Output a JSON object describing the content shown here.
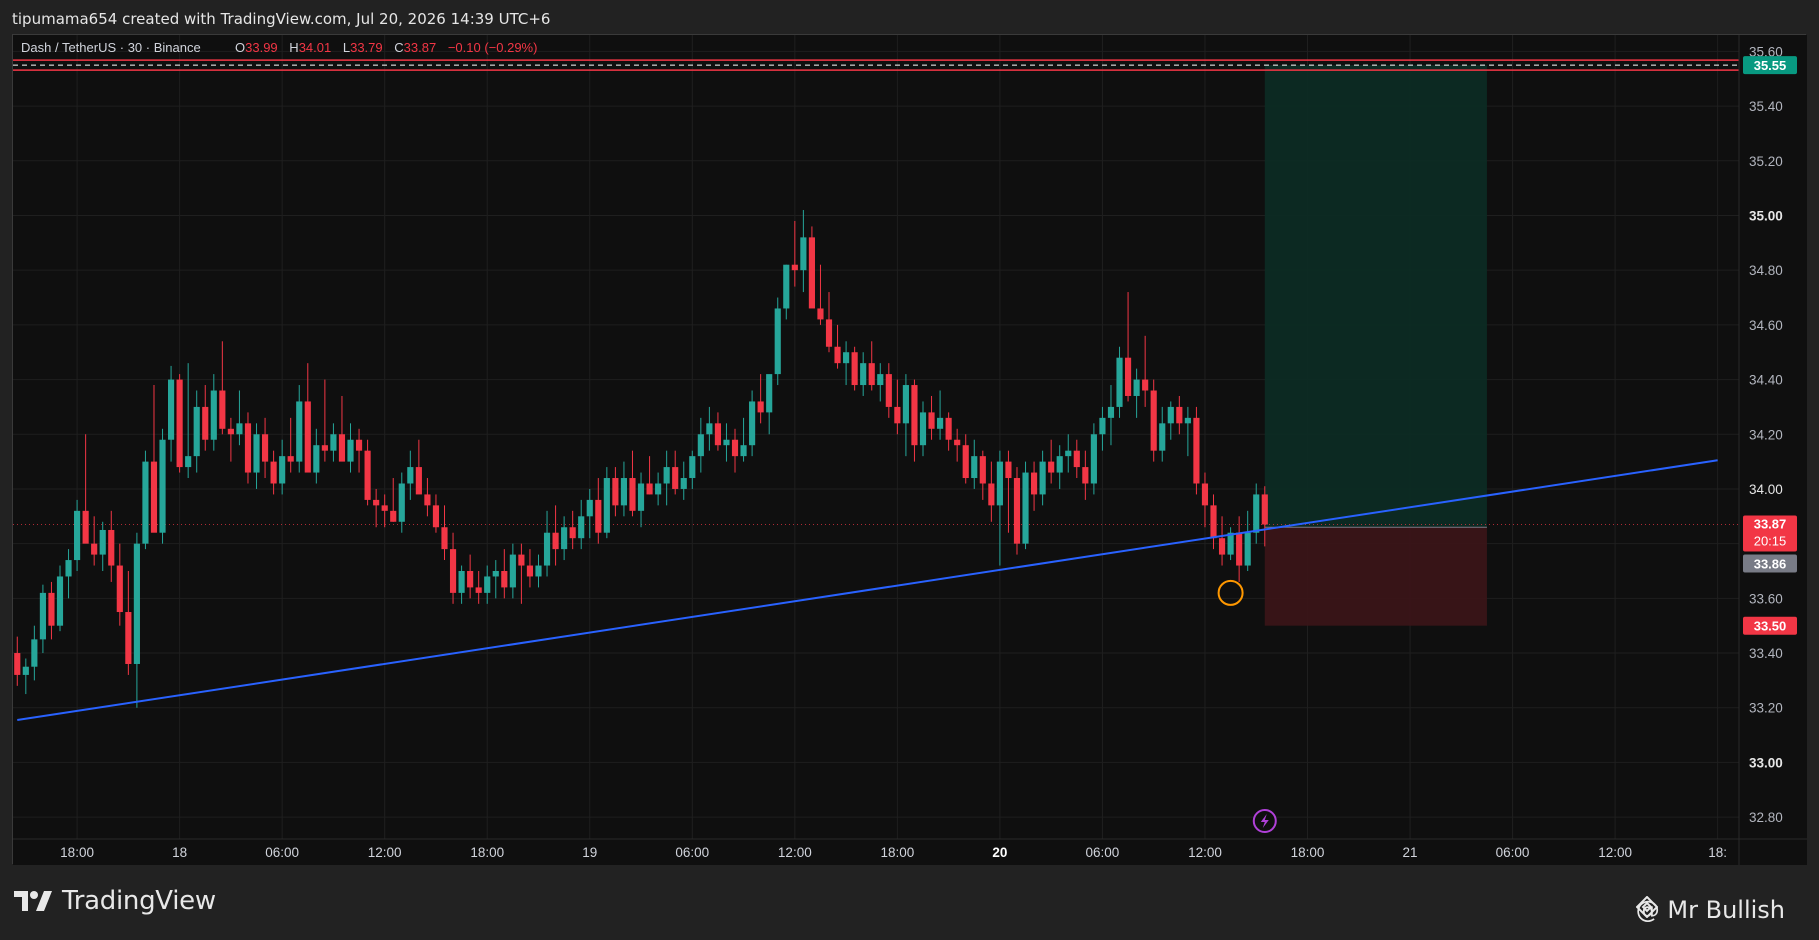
{
  "header": {
    "text": "tipumama654 created with TradingView.com, Jul 20, 2026 14:39 UTC+6"
  },
  "legend": {
    "symbol": "Dash / TetherUS · 30 · Binance",
    "o_label": "O",
    "o_value": "33.99",
    "h_label": "H",
    "h_value": "34.01",
    "l_label": "L",
    "l_value": "33.79",
    "c_label": "C",
    "c_value": "33.87",
    "change": "−0.10 (−0.29%)"
  },
  "colors": {
    "up": "#26a69a",
    "down": "#f23645",
    "trendline": "#2962ff",
    "target_zone": "#0d2b24",
    "stop_zone": "#3a1518",
    "badge_red": "#f23645",
    "badge_teal": "#089981",
    "badge_gray": "#787b86"
  },
  "footer": {
    "brand": "TradingView",
    "author": "@ Mr Bullish",
    "brand_icon": "tradingview-logo-icon",
    "author_icon": "binance-diamond-icon"
  },
  "chart_data": {
    "type": "candlestick",
    "yticks": [
      32.8,
      33.0,
      33.2,
      33.4,
      33.6,
      33.8,
      34.0,
      34.2,
      34.4,
      34.6,
      34.8,
      35.0,
      35.2,
      35.4,
      35.6
    ],
    "ytick_labels": [
      "32.80",
      "33.00",
      "33.20",
      "33.40",
      "33.60",
      "33.80",
      "34.00",
      "34.20",
      "34.40",
      "34.60",
      "34.80",
      "35.00",
      "35.20",
      "35.40",
      "35.60"
    ],
    "ylim": [
      32.72,
      35.66
    ],
    "xticks": [
      {
        "label": "18:00",
        "bar": 7
      },
      {
        "label": "18",
        "bar": 19
      },
      {
        "label": "06:00",
        "bar": 31
      },
      {
        "label": "12:00",
        "bar": 43
      },
      {
        "label": "18:00",
        "bar": 55
      },
      {
        "label": "19",
        "bar": 67
      },
      {
        "label": "06:00",
        "bar": 79
      },
      {
        "label": "12:00",
        "bar": 91
      },
      {
        "label": "18:00",
        "bar": 103
      },
      {
        "label": "20",
        "bar": 115,
        "bold": true
      },
      {
        "label": "06:00",
        "bar": 127
      },
      {
        "label": "12:00",
        "bar": 139
      },
      {
        "label": "18:00",
        "bar": 151
      },
      {
        "label": "21",
        "bar": 163
      },
      {
        "label": "06:00",
        "bar": 175
      },
      {
        "label": "12:00",
        "bar": 187
      },
      {
        "label": "18:",
        "bar": 199
      }
    ],
    "xlim_bars": [
      -0.5,
      201.5
    ],
    "ohlc": [
      [
        33.4,
        33.46,
        33.28,
        33.32
      ],
      [
        33.32,
        33.38,
        33.25,
        33.35
      ],
      [
        33.35,
        33.5,
        33.3,
        33.45
      ],
      [
        33.45,
        33.65,
        33.4,
        33.62
      ],
      [
        33.62,
        33.66,
        33.45,
        33.5
      ],
      [
        33.5,
        33.72,
        33.48,
        33.68
      ],
      [
        33.68,
        33.78,
        33.6,
        33.74
      ],
      [
        33.74,
        33.96,
        33.7,
        33.92
      ],
      [
        33.92,
        34.2,
        33.86,
        33.8
      ],
      [
        33.8,
        33.9,
        33.72,
        33.76
      ],
      [
        33.76,
        33.88,
        33.7,
        33.85
      ],
      [
        33.85,
        33.92,
        33.66,
        33.72
      ],
      [
        33.72,
        33.8,
        33.5,
        33.55
      ],
      [
        33.55,
        33.7,
        33.32,
        33.36
      ],
      [
        33.36,
        33.84,
        33.2,
        33.8
      ],
      [
        33.8,
        34.14,
        33.78,
        34.1
      ],
      [
        34.1,
        34.38,
        33.88,
        33.84
      ],
      [
        33.84,
        34.22,
        33.8,
        34.18
      ],
      [
        34.18,
        34.45,
        34.1,
        34.4
      ],
      [
        34.4,
        34.42,
        34.06,
        34.08
      ],
      [
        34.08,
        34.46,
        34.04,
        34.12
      ],
      [
        34.12,
        34.36,
        34.06,
        34.3
      ],
      [
        34.3,
        34.38,
        34.14,
        34.18
      ],
      [
        34.18,
        34.42,
        34.14,
        34.36
      ],
      [
        34.36,
        34.54,
        34.2,
        34.22
      ],
      [
        34.22,
        34.26,
        34.1,
        34.2
      ],
      [
        34.2,
        34.36,
        34.16,
        34.24
      ],
      [
        34.24,
        34.28,
        34.02,
        34.06
      ],
      [
        34.06,
        34.24,
        34.0,
        34.2
      ],
      [
        34.2,
        34.26,
        34.04,
        34.1
      ],
      [
        34.1,
        34.14,
        33.98,
        34.02
      ],
      [
        34.02,
        34.18,
        33.98,
        34.12
      ],
      [
        34.12,
        34.26,
        34.06,
        34.1
      ],
      [
        34.1,
        34.38,
        34.06,
        34.32
      ],
      [
        34.32,
        34.46,
        34.2,
        34.06
      ],
      [
        34.06,
        34.22,
        34.02,
        34.16
      ],
      [
        34.16,
        34.4,
        34.1,
        34.14
      ],
      [
        34.14,
        34.24,
        34.1,
        34.2
      ],
      [
        34.2,
        34.34,
        34.14,
        34.1
      ],
      [
        34.1,
        34.24,
        34.06,
        34.18
      ],
      [
        34.18,
        34.22,
        34.06,
        34.14
      ],
      [
        34.14,
        34.18,
        33.94,
        33.96
      ],
      [
        33.96,
        34.0,
        33.86,
        33.94
      ],
      [
        33.94,
        33.98,
        33.86,
        33.92
      ],
      [
        33.92,
        34.04,
        33.88,
        33.88
      ],
      [
        33.88,
        34.06,
        33.84,
        34.02
      ],
      [
        34.02,
        34.14,
        33.96,
        34.08
      ],
      [
        34.08,
        34.18,
        34.0,
        33.98
      ],
      [
        33.98,
        34.04,
        33.9,
        33.94
      ],
      [
        33.94,
        33.98,
        33.84,
        33.86
      ],
      [
        33.86,
        33.94,
        33.74,
        33.78
      ],
      [
        33.78,
        33.84,
        33.58,
        33.62
      ],
      [
        33.62,
        33.72,
        33.58,
        33.7
      ],
      [
        33.7,
        33.76,
        33.6,
        33.64
      ],
      [
        33.64,
        33.7,
        33.58,
        33.62
      ],
      [
        33.62,
        33.72,
        33.58,
        33.68
      ],
      [
        33.68,
        33.74,
        33.6,
        33.7
      ],
      [
        33.7,
        33.78,
        33.6,
        33.64
      ],
      [
        33.64,
        33.8,
        33.6,
        33.76
      ],
      [
        33.76,
        33.8,
        33.58,
        33.72
      ],
      [
        33.72,
        33.78,
        33.64,
        33.68
      ],
      [
        33.68,
        33.76,
        33.64,
        33.72
      ],
      [
        33.72,
        33.92,
        33.68,
        33.84
      ],
      [
        33.84,
        33.94,
        33.72,
        33.78
      ],
      [
        33.78,
        33.9,
        33.74,
        33.86
      ],
      [
        33.86,
        33.92,
        33.78,
        33.82
      ],
      [
        33.82,
        33.96,
        33.78,
        33.9
      ],
      [
        33.9,
        34.0,
        33.82,
        33.96
      ],
      [
        33.96,
        34.04,
        33.8,
        33.84
      ],
      [
        33.84,
        34.08,
        33.82,
        34.04
      ],
      [
        34.04,
        34.08,
        33.9,
        33.94
      ],
      [
        33.94,
        34.1,
        33.9,
        34.04
      ],
      [
        34.04,
        34.14,
        33.9,
        33.92
      ],
      [
        33.92,
        34.06,
        33.86,
        34.02
      ],
      [
        34.02,
        34.12,
        33.98,
        33.98
      ],
      [
        33.98,
        34.06,
        33.94,
        34.02
      ],
      [
        34.02,
        34.14,
        33.94,
        34.08
      ],
      [
        34.08,
        34.14,
        33.98,
        34.0
      ],
      [
        34.0,
        34.1,
        33.96,
        34.04
      ],
      [
        34.04,
        34.14,
        34.0,
        34.12
      ],
      [
        34.12,
        34.26,
        34.06,
        34.2
      ],
      [
        34.2,
        34.3,
        34.14,
        34.24
      ],
      [
        34.24,
        34.28,
        34.14,
        34.16
      ],
      [
        34.16,
        34.24,
        34.1,
        34.18
      ],
      [
        34.18,
        34.22,
        34.06,
        34.12
      ],
      [
        34.12,
        34.26,
        34.1,
        34.16
      ],
      [
        34.16,
        34.36,
        34.12,
        34.32
      ],
      [
        34.32,
        34.42,
        34.24,
        34.28
      ],
      [
        34.28,
        34.4,
        34.2,
        34.42
      ],
      [
        34.42,
        34.7,
        34.38,
        34.66
      ],
      [
        34.66,
        34.82,
        34.62,
        34.82
      ],
      [
        34.82,
        34.98,
        34.74,
        34.8
      ],
      [
        34.8,
        35.02,
        34.72,
        34.92
      ],
      [
        34.92,
        34.96,
        34.78,
        34.66
      ],
      [
        34.66,
        34.82,
        34.6,
        34.62
      ],
      [
        34.62,
        34.72,
        34.5,
        34.52
      ],
      [
        34.52,
        34.6,
        34.44,
        34.46
      ],
      [
        34.46,
        34.54,
        34.38,
        34.5
      ],
      [
        34.5,
        34.52,
        34.36,
        34.38
      ],
      [
        34.38,
        34.5,
        34.34,
        34.46
      ],
      [
        34.46,
        34.54,
        34.36,
        34.38
      ],
      [
        34.38,
        34.46,
        34.32,
        34.42
      ],
      [
        34.42,
        34.46,
        34.26,
        34.3
      ],
      [
        34.3,
        34.4,
        34.2,
        34.24
      ],
      [
        34.24,
        34.42,
        34.12,
        34.38
      ],
      [
        34.38,
        34.4,
        34.1,
        34.16
      ],
      [
        34.16,
        34.32,
        34.12,
        34.28
      ],
      [
        34.28,
        34.34,
        34.18,
        34.22
      ],
      [
        34.22,
        34.36,
        34.18,
        34.26
      ],
      [
        34.26,
        34.28,
        34.14,
        34.18
      ],
      [
        34.18,
        34.22,
        34.1,
        34.16
      ],
      [
        34.16,
        34.2,
        34.02,
        34.04
      ],
      [
        34.04,
        34.18,
        34.0,
        34.12
      ],
      [
        34.12,
        34.14,
        33.96,
        34.02
      ],
      [
        34.02,
        34.1,
        33.88,
        33.94
      ],
      [
        33.94,
        34.14,
        33.72,
        34.1
      ],
      [
        34.1,
        34.14,
        33.84,
        34.04
      ],
      [
        34.04,
        34.08,
        33.76,
        33.8
      ],
      [
        33.8,
        34.1,
        33.78,
        34.06
      ],
      [
        34.06,
        34.1,
        33.92,
        33.98
      ],
      [
        33.98,
        34.14,
        33.94,
        34.1
      ],
      [
        34.1,
        34.18,
        34.02,
        34.06
      ],
      [
        34.06,
        34.16,
        34.0,
        34.12
      ],
      [
        34.12,
        34.2,
        34.06,
        34.14
      ],
      [
        34.14,
        34.18,
        34.04,
        34.08
      ],
      [
        34.08,
        34.14,
        33.96,
        34.02
      ],
      [
        34.02,
        34.24,
        33.98,
        34.2
      ],
      [
        34.2,
        34.3,
        34.14,
        34.26
      ],
      [
        34.26,
        34.38,
        34.16,
        34.3
      ],
      [
        34.3,
        34.52,
        34.26,
        34.48
      ],
      [
        34.48,
        34.72,
        34.32,
        34.34
      ],
      [
        34.34,
        34.44,
        34.26,
        34.4
      ],
      [
        34.4,
        34.56,
        34.3,
        34.36
      ],
      [
        34.36,
        34.4,
        34.1,
        34.14
      ],
      [
        34.14,
        34.3,
        34.1,
        34.24
      ],
      [
        34.24,
        34.32,
        34.18,
        34.3
      ],
      [
        34.3,
        34.34,
        34.2,
        34.24
      ],
      [
        34.24,
        34.3,
        34.12,
        34.26
      ],
      [
        34.26,
        34.3,
        33.98,
        34.02
      ],
      [
        34.02,
        34.06,
        33.86,
        33.94
      ],
      [
        33.94,
        33.98,
        33.78,
        33.82
      ],
      [
        33.82,
        33.9,
        33.72,
        33.76
      ],
      [
        33.76,
        33.86,
        33.74,
        33.84
      ],
      [
        33.84,
        33.9,
        33.66,
        33.72
      ],
      [
        33.72,
        33.92,
        33.7,
        33.84
      ],
      [
        33.84,
        34.02,
        33.8,
        33.98
      ],
      [
        33.98,
        34.01,
        33.79,
        33.87
      ]
    ],
    "annotations": {
      "resistance_price": 35.55,
      "resistance_label": "35.55",
      "last_price": 33.87,
      "last_price_label": "33.87",
      "countdown_label": "20:15",
      "crosshair_price_label": "33.86",
      "stop_price": 33.5,
      "stop_label": "33.50",
      "trendline": {
        "start_bar": 0,
        "start_price": 33.155,
        "end_bar": 199,
        "end_price": 34.105
      },
      "position": {
        "start_bar": 146,
        "end_bar": 172,
        "entry": 33.86,
        "target": 35.55,
        "stop": 33.5
      },
      "circle_marker": {
        "bar": 142,
        "price": 33.62
      },
      "event_marker": {
        "bar": 146,
        "icon": "lightning-icon"
      }
    }
  }
}
